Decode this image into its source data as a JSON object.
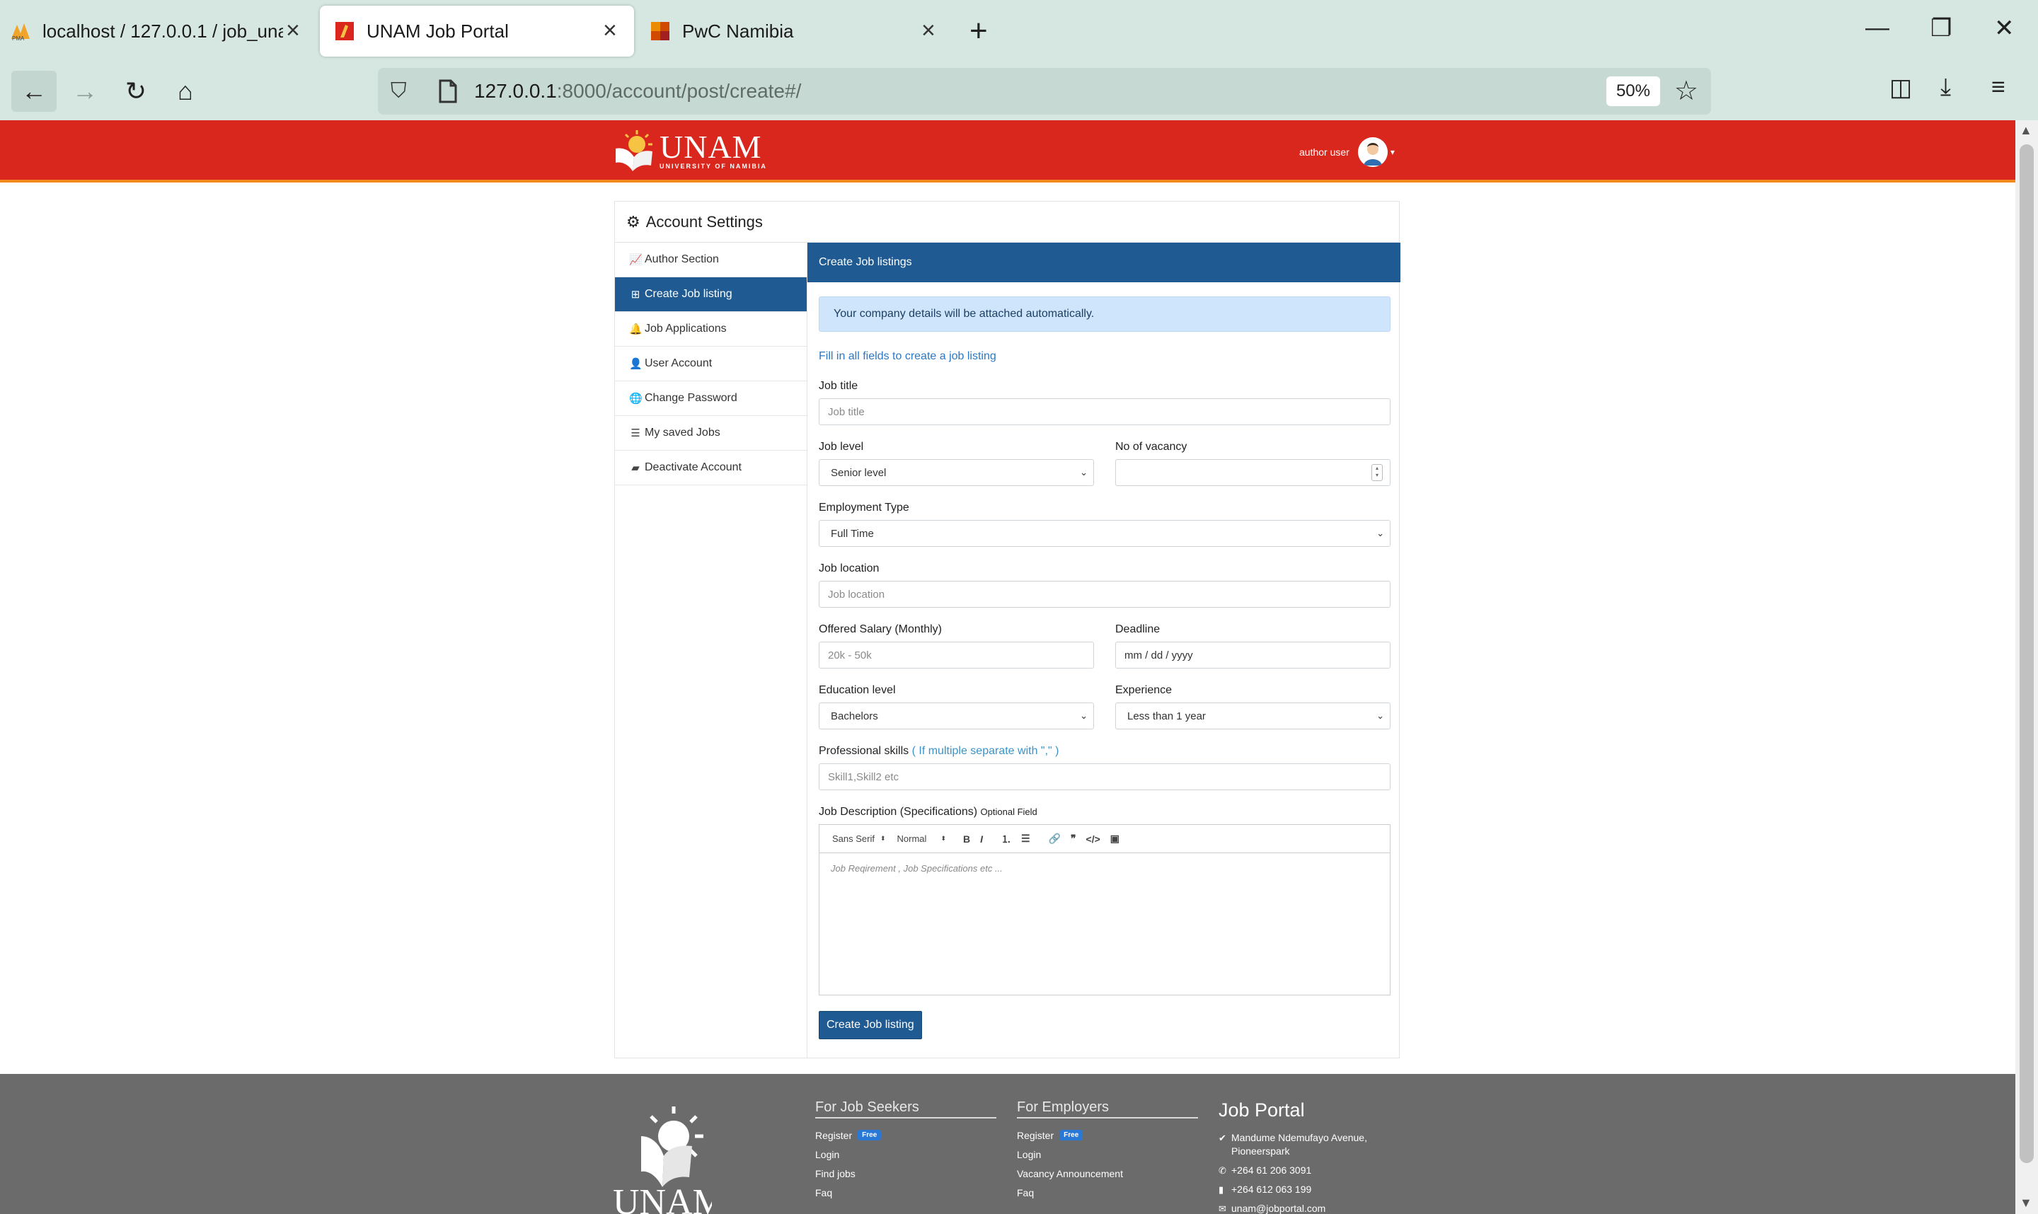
{
  "browser": {
    "tabs": [
      {
        "title": "localhost / 127.0.0.1 / job_unam"
      },
      {
        "title": "UNAM Job Portal"
      },
      {
        "title": "PwC Namibia"
      }
    ],
    "url_host": "127.0.0.1",
    "url_rest": ":8000/account/post/create#/",
    "zoom": "50%"
  },
  "header": {
    "logo_name": "UNAM",
    "logo_sub": "UNIVERSITY OF NAMIBIA",
    "user_name": "author user"
  },
  "card": {
    "title": "Account Settings"
  },
  "sidebar": {
    "items": [
      {
        "label": "Author Section",
        "icon": "chart-line-icon"
      },
      {
        "label": "Create Job listing",
        "icon": "plus-square-icon",
        "active": true
      },
      {
        "label": "Job Applications",
        "icon": "bell-icon"
      },
      {
        "label": "User Account",
        "icon": "user-cog-icon"
      },
      {
        "label": "Change Password",
        "icon": "globe-icon"
      },
      {
        "label": "My saved Jobs",
        "icon": "list-icon"
      },
      {
        "label": "Deactivate Account",
        "icon": "folder-icon"
      }
    ]
  },
  "form": {
    "panel_title": "Create Job listings",
    "alert": "Your company details will be attached automatically.",
    "hint": "Fill in all fields to create a job listing",
    "job_title": {
      "label": "Job title",
      "placeholder": "Job title"
    },
    "job_level": {
      "label": "Job level",
      "value": "Senior level"
    },
    "vacancy": {
      "label": "No of vacancy",
      "value": ""
    },
    "employment_type": {
      "label": "Employment Type",
      "value": "Full Time"
    },
    "job_location": {
      "label": "Job location",
      "placeholder": "Job location"
    },
    "salary": {
      "label": "Offered Salary (Monthly)",
      "placeholder": "20k - 50k"
    },
    "deadline": {
      "label": "Deadline",
      "placeholder": "mm / dd / yyyy"
    },
    "education": {
      "label": "Education level",
      "value": "Bachelors"
    },
    "experience": {
      "label": "Experience",
      "value": "Less than 1 year"
    },
    "skills": {
      "label": "Professional skills",
      "note": "( If multiple separate with \",\" )",
      "placeholder": "Skill1,Skill2 etc"
    },
    "description": {
      "label": "Job Description (Specifications)",
      "optional": "Optional Field",
      "font": "Sans Serif",
      "size": "Normal",
      "placeholder": "Job Reqirement , Job Specifications etc ..."
    },
    "submit": "Create Job listing"
  },
  "footer": {
    "seekers": {
      "title": "For Job Seekers",
      "links": [
        "Register",
        "Login",
        "Find jobs",
        "Faq"
      ],
      "badge": "Free"
    },
    "employers": {
      "title": "For Employers",
      "links": [
        "Register",
        "Login",
        "Vacancy Announcement",
        "Faq"
      ],
      "badge": "Free"
    },
    "contact": {
      "title": "Job Portal",
      "address": "Mandume Ndemufayo Avenue, Pioneerspark",
      "phone": "+264 61 206 3091",
      "mobile": "+264 612 063 199",
      "email": "unam@jobportal.com"
    }
  }
}
